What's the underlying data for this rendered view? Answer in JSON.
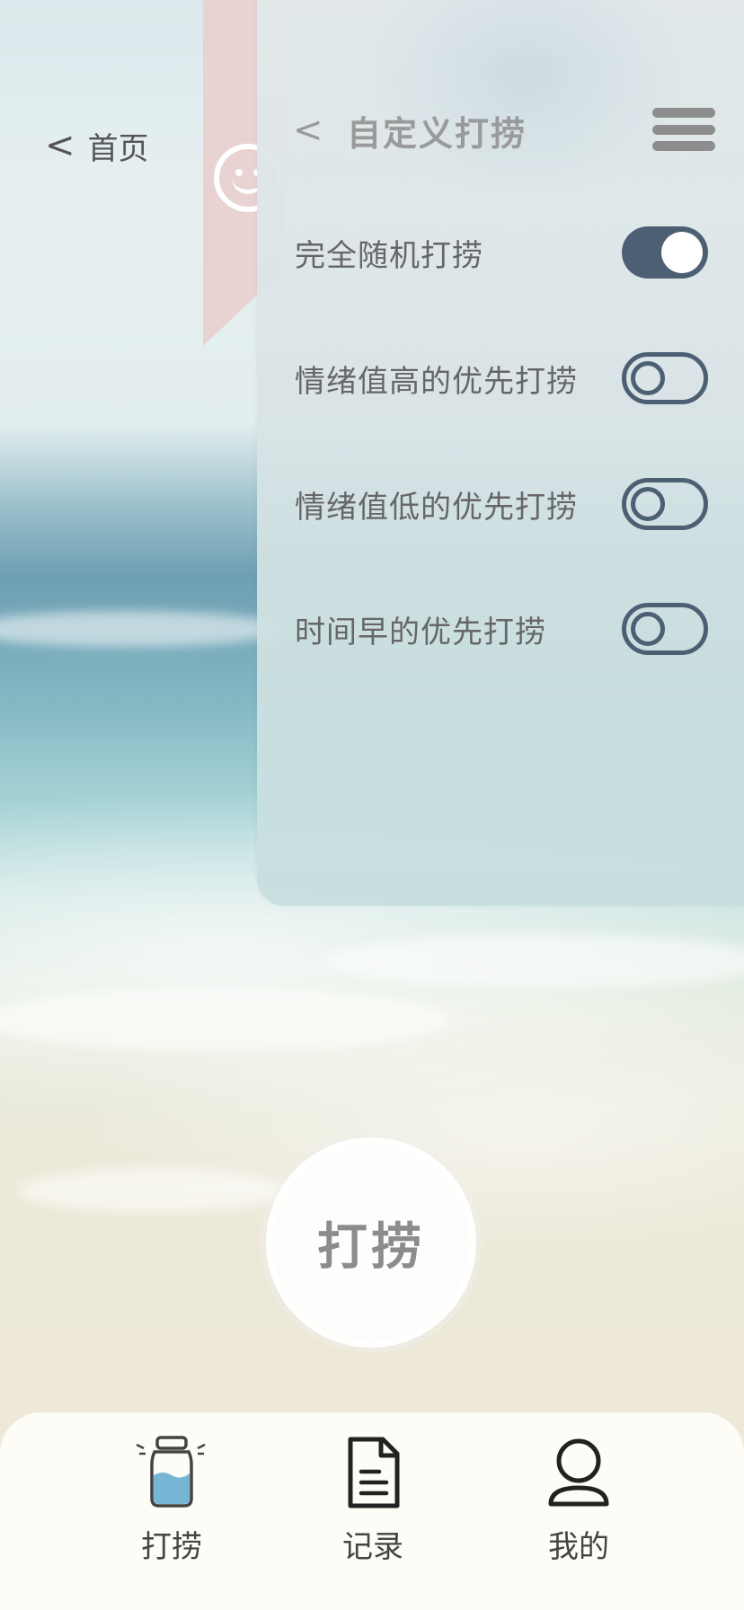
{
  "top_nav": {
    "back_glyph": "<",
    "home_label": "首页"
  },
  "panel": {
    "back_glyph": "<",
    "title": "自定义打捞",
    "menu_icon": "hamburger-icon",
    "options": [
      {
        "label": "完全随机打捞",
        "on": true
      },
      {
        "label": "情绪值高的优先打捞",
        "on": false
      },
      {
        "label": "情绪值低的优先打捞",
        "on": false
      },
      {
        "label": "时间早的优先打捞",
        "on": false
      }
    ]
  },
  "main_button": {
    "label": "打捞"
  },
  "tabbar": {
    "tabs": [
      {
        "label": "打捞",
        "icon": "bottle-icon"
      },
      {
        "label": "记录",
        "icon": "document-icon"
      },
      {
        "label": "我的",
        "icon": "person-icon"
      }
    ]
  },
  "colors": {
    "toggle_accent": "#4d6073",
    "ribbon": "#e8d3d2",
    "tabbar_bg": "#fdfcf6"
  }
}
